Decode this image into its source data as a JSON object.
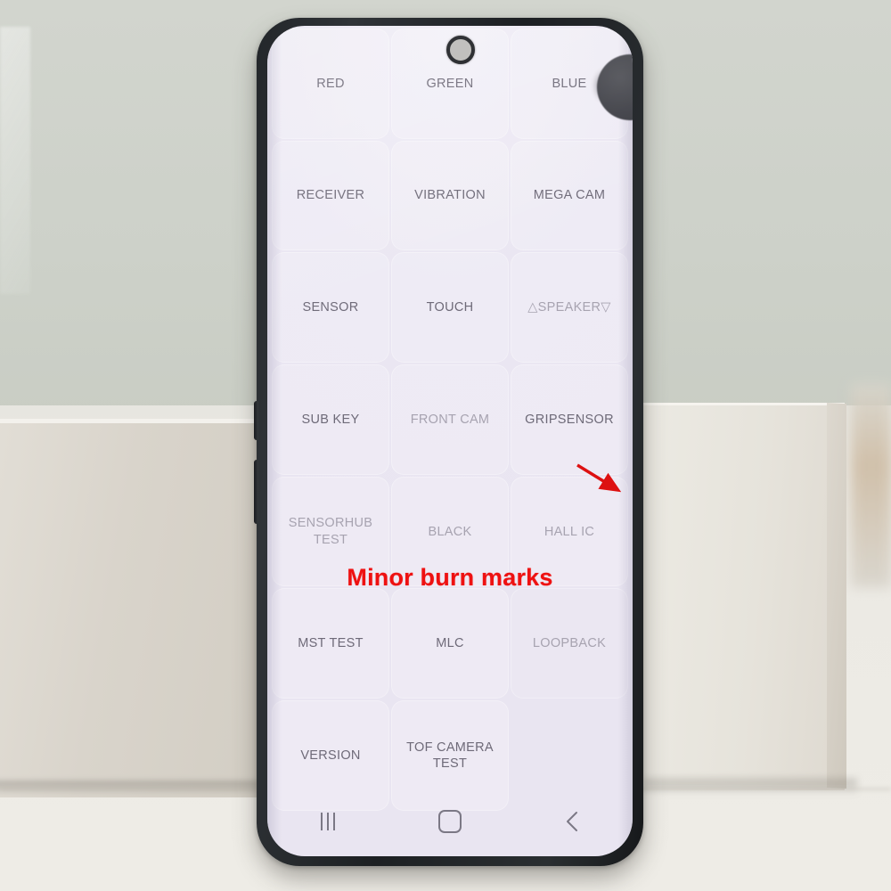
{
  "scene": {
    "description": "Smartphone displaying a Samsung hardware diagnostic test menu, propped against a box",
    "background_color": "#cfd2cb",
    "floor_color": "#eceae4"
  },
  "device": {
    "bezel_color": "#23262a",
    "screen_background": "#eae6f2",
    "camera": "punch-hole-camera"
  },
  "test_menu": {
    "title": "Hardware Diagnostic Test Grid",
    "columns": 3,
    "rows": 7,
    "cells": [
      {
        "label": "RED",
        "state": "normal"
      },
      {
        "label": "GREEN",
        "state": "normal"
      },
      {
        "label": "BLUE",
        "state": "normal"
      },
      {
        "label": "RECEIVER",
        "state": "normal"
      },
      {
        "label": "VIBRATION",
        "state": "normal"
      },
      {
        "label": "MEGA CAM",
        "state": "normal"
      },
      {
        "label": "SENSOR",
        "state": "normal"
      },
      {
        "label": "TOUCH",
        "state": "normal"
      },
      {
        "label": "△SPEAKER▽",
        "state": "dim"
      },
      {
        "label": "SUB KEY",
        "state": "normal"
      },
      {
        "label": "FRONT CAM",
        "state": "dim"
      },
      {
        "label": "GRIPSENSOR",
        "state": "normal"
      },
      {
        "label": "SENSORHUB TEST",
        "state": "dim"
      },
      {
        "label": "BLACK",
        "state": "dim"
      },
      {
        "label": "HALL IC",
        "state": "dim"
      },
      {
        "label": "MST TEST",
        "state": "normal"
      },
      {
        "label": "MLC",
        "state": "normal"
      },
      {
        "label": "LOOPBACK",
        "state": "dim"
      },
      {
        "label": "VERSION",
        "state": "normal"
      },
      {
        "label": "TOF CAMERA TEST",
        "state": "normal"
      },
      {
        "label": "",
        "state": "empty"
      }
    ]
  },
  "annotation": {
    "text": "Minor burn marks",
    "color": "#ee1111",
    "arrow_color": "#dd1111",
    "points_at": "burn-mark-spot"
  },
  "navigation_bar": {
    "buttons": [
      {
        "name": "recents",
        "glyph": "|||"
      },
      {
        "name": "home",
        "glyph": "○"
      },
      {
        "name": "back",
        "glyph": "‹"
      }
    ]
  }
}
